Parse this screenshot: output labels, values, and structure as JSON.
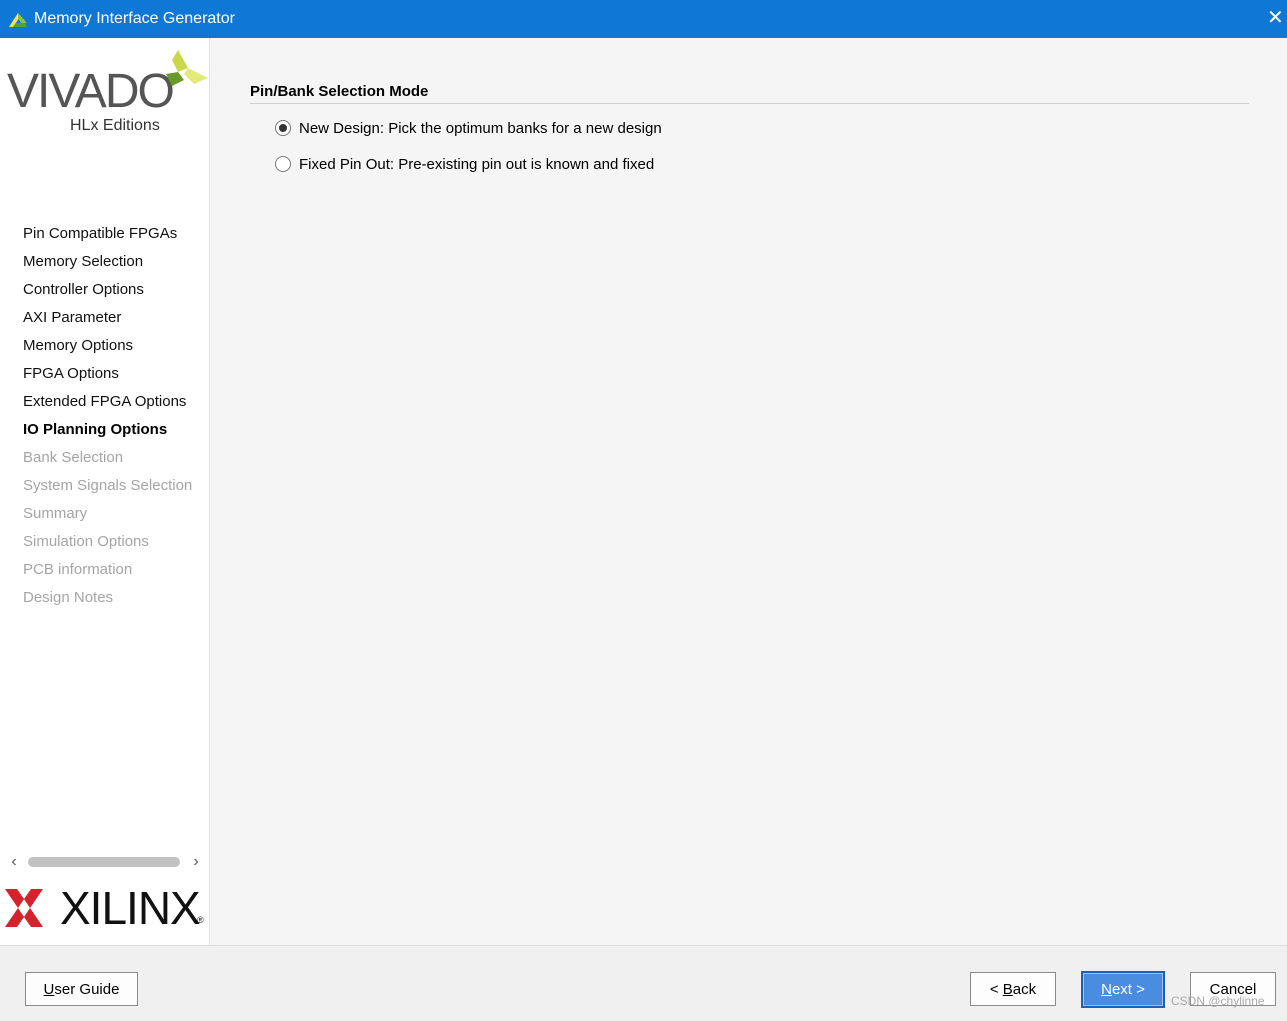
{
  "window": {
    "title": "Memory Interface Generator",
    "close_glyph": "✕"
  },
  "branding": {
    "vivado_word": "VIVADO",
    "vivado_sub": "HLx Editions",
    "xilinx_word": "XILINX",
    "xilinx_reg": "®"
  },
  "steps": [
    {
      "label": "Pin Compatible FPGAs",
      "state": "done"
    },
    {
      "label": "Memory Selection",
      "state": "done"
    },
    {
      "label": "Controller Options",
      "state": "done"
    },
    {
      "label": "AXI Parameter",
      "state": "done"
    },
    {
      "label": "Memory Options",
      "state": "done"
    },
    {
      "label": "FPGA Options",
      "state": "done"
    },
    {
      "label": "Extended FPGA Options",
      "state": "done"
    },
    {
      "label": "IO Planning Options",
      "state": "active"
    },
    {
      "label": "Bank Selection",
      "state": "pending"
    },
    {
      "label": "System Signals Selection",
      "state": "pending"
    },
    {
      "label": "Summary",
      "state": "pending"
    },
    {
      "label": "Simulation Options",
      "state": "pending"
    },
    {
      "label": "PCB information",
      "state": "pending"
    },
    {
      "label": "Design Notes",
      "state": "pending"
    }
  ],
  "scroll": {
    "left_glyph": "‹",
    "right_glyph": "›"
  },
  "main": {
    "section_title": "Pin/Bank Selection Mode",
    "options": [
      {
        "label": "New Design: Pick the optimum banks for a new design",
        "selected": true
      },
      {
        "label": "Fixed Pin Out: Pre-existing pin out is known and fixed",
        "selected": false
      }
    ]
  },
  "buttons": {
    "user_guide_mn": "U",
    "user_guide_rest": "ser Guide",
    "back_prefix": "< ",
    "back_mn": "B",
    "back_rest": "ack",
    "next_mn": "N",
    "next_rest": "ext >",
    "cancel": "Cancel"
  },
  "watermark": "CSDN @chylinne",
  "colors": {
    "titlebar": "#0f78d7",
    "primary_button": "#4a8ce0",
    "pending_step": "#a5a5a5"
  }
}
